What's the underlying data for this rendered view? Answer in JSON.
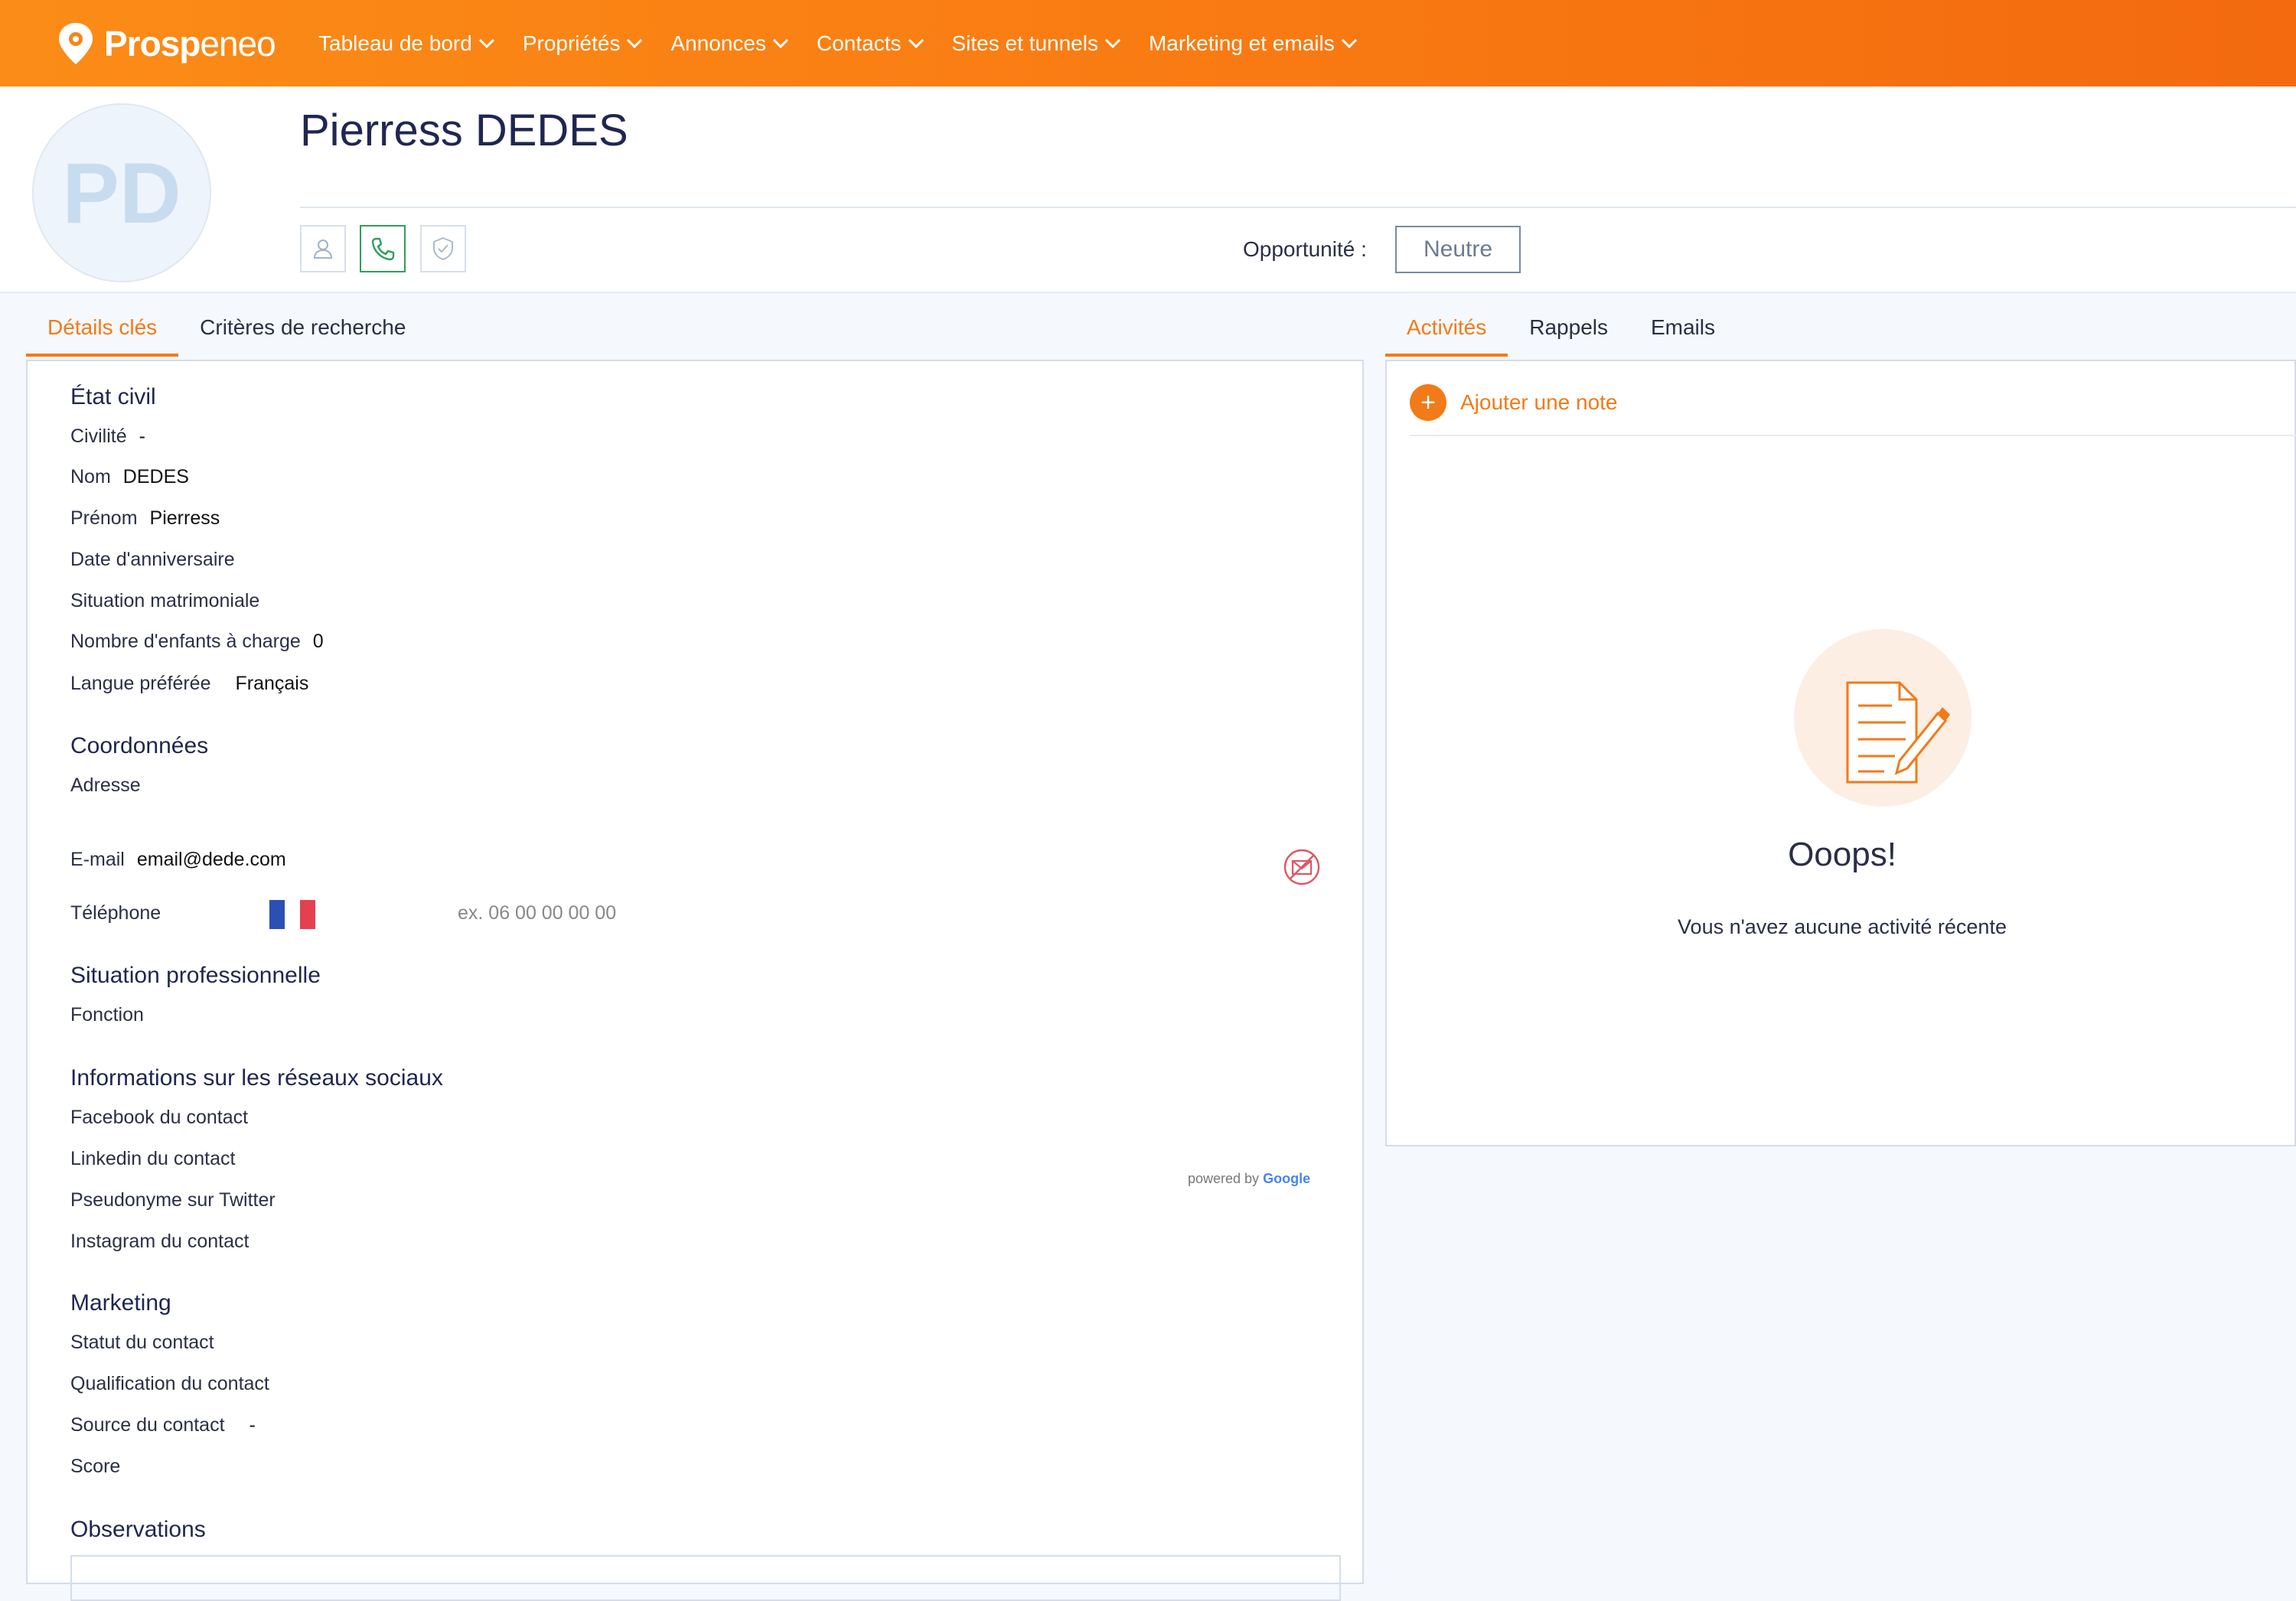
{
  "app": {
    "brand_bold": "Prosp",
    "brand_light": "eneo",
    "accent_color": "#f27a18"
  },
  "nav": {
    "items": [
      {
        "label": "Tableau de bord"
      },
      {
        "label": "Propriétés"
      },
      {
        "label": "Annonces"
      },
      {
        "label": "Contacts"
      },
      {
        "label": "Sites et tunnels"
      },
      {
        "label": "Marketing et emails"
      }
    ]
  },
  "contact": {
    "initials": "PD",
    "full_name": "Pierress DEDES",
    "opportunity_label": "Opportunité :",
    "opportunity_value": "Neutre"
  },
  "left_tabs": [
    {
      "label": "Détails clés",
      "active": true
    },
    {
      "label": "Critères de recherche",
      "active": false
    }
  ],
  "right_tabs": [
    {
      "label": "Activités",
      "active": true
    },
    {
      "label": "Rappels",
      "active": false
    },
    {
      "label": "Emails",
      "active": false
    }
  ],
  "details": {
    "etat_civil": {
      "title": "État civil",
      "civilite_label": "Civilité",
      "civilite_value": "-",
      "nom_label": "Nom",
      "nom_value": "DEDES",
      "prenom_label": "Prénom",
      "prenom_value": "Pierress",
      "anniversaire_label": "Date d'anniversaire",
      "situation_label": "Situation matrimoniale",
      "enfants_label": "Nombre d'enfants à charge",
      "enfants_value": "0",
      "langue_label": "Langue préférée",
      "langue_value": "Français"
    },
    "coordonnees": {
      "title": "Coordonnées",
      "adresse_label": "Adresse",
      "powered_by": "powered by",
      "powered_brand": "Google",
      "email_label": "E-mail",
      "email_value": "email@dede.com",
      "telephone_label": "Téléphone",
      "telephone_placeholder": "ex. 06 00 00 00 00"
    },
    "professionnel": {
      "title": "Situation professionnelle",
      "fonction_label": "Fonction"
    },
    "reseaux": {
      "title": "Informations sur les réseaux sociaux",
      "facebook_label": "Facebook du contact",
      "linkedin_label": "Linkedin du contact",
      "twitter_label": "Pseudonyme sur Twitter",
      "instagram_label": "Instagram du contact"
    },
    "marketing": {
      "title": "Marketing",
      "statut_label": "Statut du contact",
      "qualification_label": "Qualification du contact",
      "source_label": "Source du contact",
      "source_value": "-",
      "score_label": "Score"
    },
    "observations": {
      "title": "Observations"
    }
  },
  "activities": {
    "add_note_label": "Ajouter une note",
    "empty_title": "Ooops!",
    "empty_subtitle": "Vous n'avez aucune activité récente"
  }
}
